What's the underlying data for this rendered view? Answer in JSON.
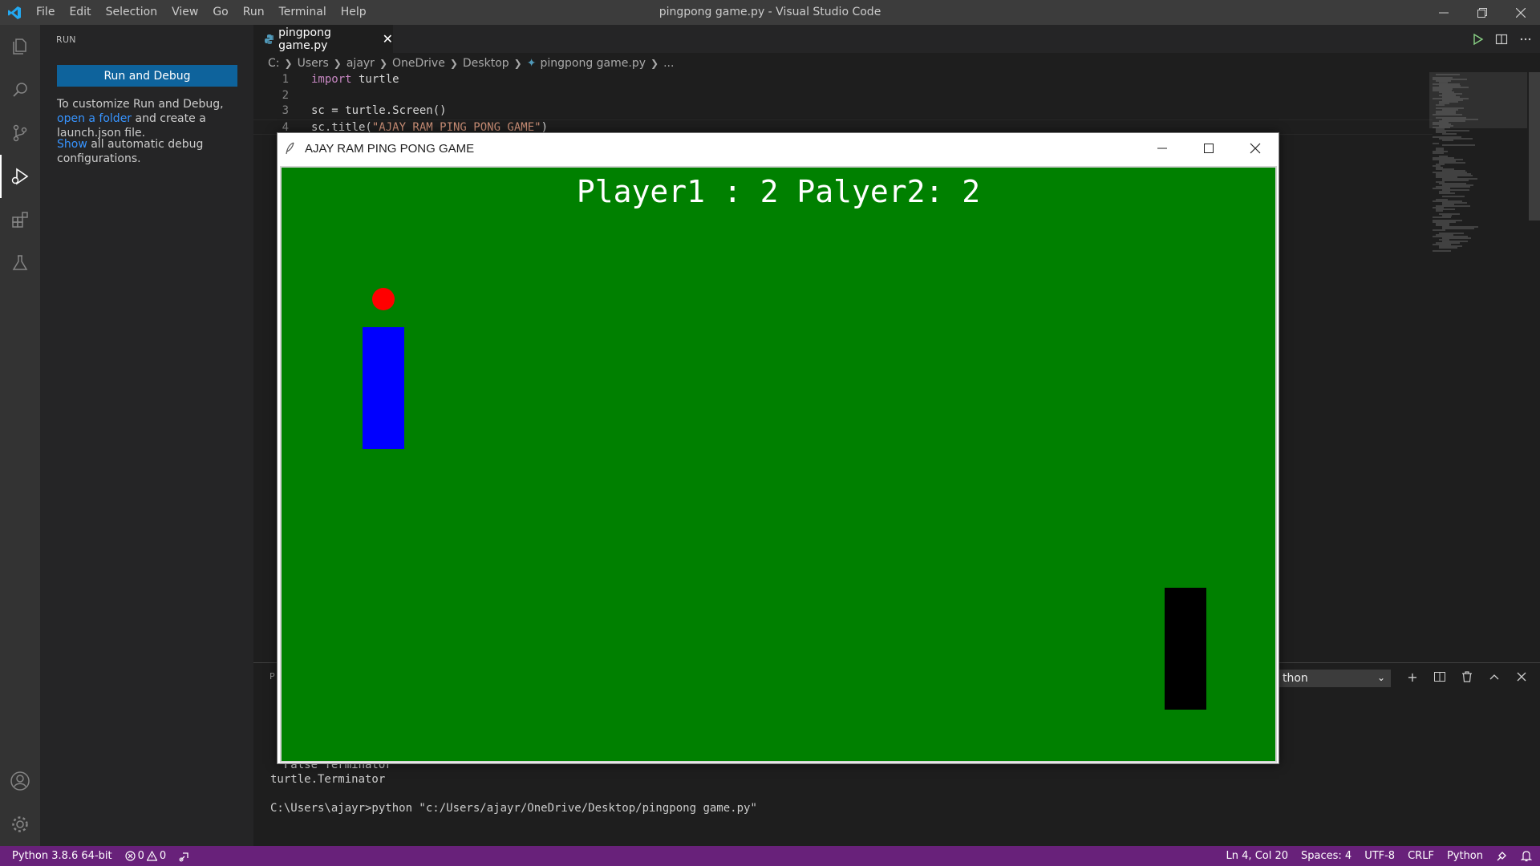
{
  "app": {
    "window_title": "pingpong game.py - Visual Studio Code",
    "menu": [
      "File",
      "Edit",
      "Selection",
      "View",
      "Go",
      "Run",
      "Terminal",
      "Help"
    ]
  },
  "sidebar": {
    "title": "RUN",
    "run_button": "Run and Debug",
    "customize": {
      "prefix": "To customize Run and Debug, ",
      "link": "open a folder",
      "suffix": " and create a launch.json file."
    },
    "show": {
      "link": "Show",
      "suffix": " all automatic debug configurations."
    }
  },
  "editor": {
    "tab_label": "pingpong game.py",
    "breadcrumb": [
      "C:",
      "Users",
      "ajayr",
      "OneDrive",
      "Desktop",
      "pingpong game.py",
      "..."
    ],
    "lines": [
      {
        "num": "1",
        "kw": "import",
        "rest": " turtle",
        "str": "",
        "tail": ""
      },
      {
        "num": "2",
        "kw": "",
        "rest": "",
        "str": "",
        "tail": ""
      },
      {
        "num": "3",
        "kw": "",
        "rest": "sc = turtle.Screen()",
        "str": "",
        "tail": ""
      },
      {
        "num": "4",
        "kw": "",
        "rest": "sc.title(",
        "str": "\"AJAY RAM PING PONG GAME\"",
        "tail": ")"
      }
    ]
  },
  "panel": {
    "tab_partial": "P",
    "terminal_select": "thon",
    "lines": [
      "  False Terminator",
      "turtle.Terminator",
      "",
      "C:\\Users\\ajayr>python \"c:/Users/ajayr/OneDrive/Desktop/pingpong game.py\""
    ]
  },
  "statusbar": {
    "python": "Python 3.8.6 64-bit",
    "errors": "0",
    "warnings": "0",
    "position": "Ln 4, Col 20",
    "spaces": "Spaces: 4",
    "encoding": "UTF-8",
    "eol": "CRLF",
    "language": "Python"
  },
  "turtle_window": {
    "title": "AJAY RAM PING PONG GAME",
    "score": "Player1 : 2 Palyer2: 2",
    "colors": {
      "background": "#008000",
      "ball": "#ff0000",
      "paddle_a": "#0000ff",
      "paddle_b": "#000000"
    }
  },
  "colors": {
    "statusbar": "#68217a",
    "accent_button": "#0e639c"
  }
}
